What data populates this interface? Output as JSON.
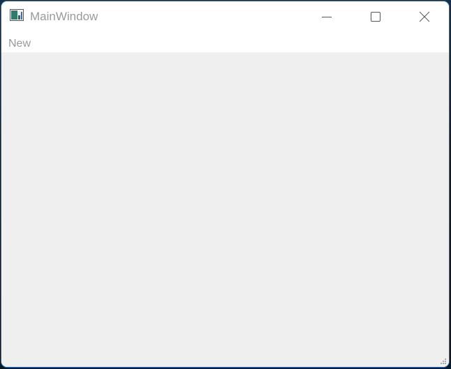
{
  "window": {
    "title": "MainWindow",
    "icon": "app-window-icon"
  },
  "caption_buttons": [
    {
      "name": "minimize",
      "icon": "minimize-icon"
    },
    {
      "name": "maximize",
      "icon": "maximize-icon"
    },
    {
      "name": "close",
      "icon": "close-icon"
    }
  ],
  "menubar": {
    "items": [
      {
        "label": "New"
      }
    ]
  },
  "colors": {
    "titlebar_bg": "#ffffff",
    "client_bg": "#efefef",
    "text_disabled": "#9a9a9a",
    "window_border": "#1e6fb8"
  }
}
